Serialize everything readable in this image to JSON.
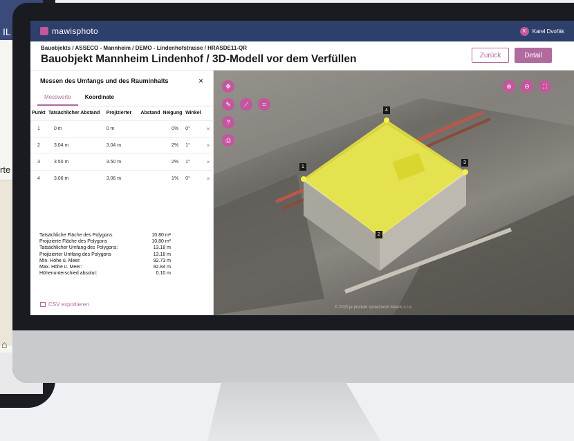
{
  "phone": {
    "top_text": "IL",
    "side_text": "rte"
  },
  "app": {
    "brand": "mawisphoto",
    "user_initial": "K",
    "user_name": "Karel Dvořák"
  },
  "header": {
    "breadcrumb": "Bauobjekts / ASSECO - Mannheim / DEMO - Lindenhofstrasse / HRASDE11-QR",
    "title": "Bauobjekt Mannheim Lindenhof / 3D-Modell vor dem Verfüllen",
    "back_label": "Zurück",
    "detail_label": "Detail"
  },
  "panel": {
    "title": "Messen des Umfangs und des Rauminhalts",
    "close": "×",
    "tabs": [
      "Messwerte",
      "Koordinate"
    ],
    "columns": [
      "Punkt",
      "Tatsächlicher Abstand",
      "Projizierter",
      "Abstand",
      "Neigung",
      "Winkel"
    ],
    "rows": [
      {
        "punkt": "1",
        "tats": "0 m",
        "proj": "0 m",
        "neigung": "0%",
        "winkel": "0°",
        "del": "×"
      },
      {
        "punkt": "2",
        "tats": "3.04 m",
        "proj": "3.04 m",
        "neigung": "2%",
        "winkel": "1°",
        "del": "×"
      },
      {
        "punkt": "3",
        "tats": "3.50 m",
        "proj": "3.50 m",
        "neigung": "2%",
        "winkel": "1°",
        "del": "×"
      },
      {
        "punkt": "4",
        "tats": "3.06 m",
        "proj": "3.06 m",
        "neigung": "1%",
        "winkel": "0°",
        "del": "×"
      }
    ],
    "stats": [
      {
        "label": "Tatsächliche Fläche des Polygons",
        "value": "10.80 m²"
      },
      {
        "label": "Projizierte Fläche des Polygons",
        "value": "10.80 m²"
      },
      {
        "label": "Tatsächlicher Umfang des Polygons:",
        "value": "13.18 m"
      },
      {
        "label": "Projizierter Umfang des Polygons",
        "value": "13.18 m"
      },
      {
        "label": "Min. Höhe ü. Meer:",
        "value": "92.73 m"
      },
      {
        "label": "Max. Höhe ü. Meer:",
        "value": "92.84 m"
      },
      {
        "label": "Höhenunterschied absolut:",
        "value": "0.10 m"
      }
    ],
    "csv_label": "CSV exportieren"
  },
  "viewer": {
    "point_labels": [
      "1",
      "2",
      "3",
      "4"
    ],
    "attribution": "© 2020 je produkt společnosti Mawis s.r.o."
  },
  "colors": {
    "accent": "#b06a9d",
    "brand": "#c2579e",
    "appbar": "#2d3f6b",
    "polygon": "#e8e63a"
  }
}
